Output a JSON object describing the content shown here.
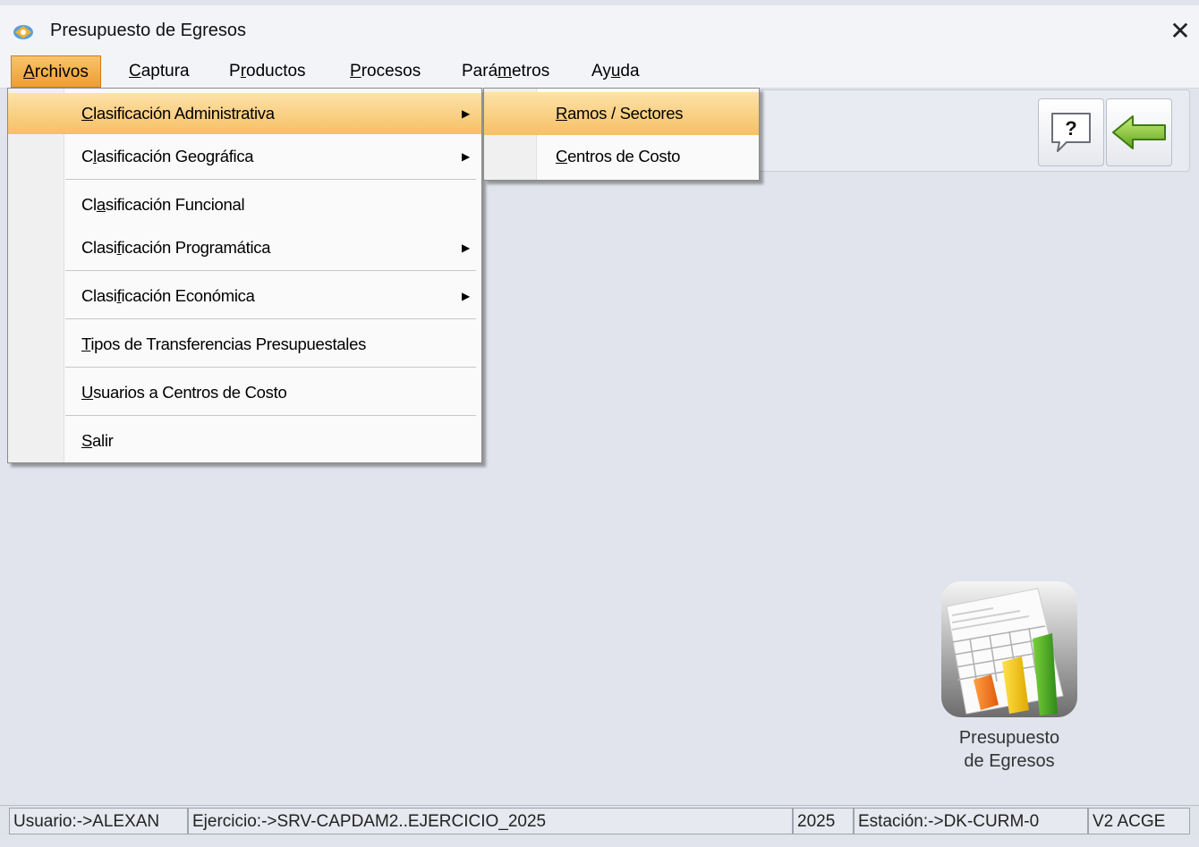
{
  "window": {
    "title": "Presupuesto de Egresos",
    "close_glyph": "✕"
  },
  "menubar": {
    "items": [
      {
        "label": "Archivos",
        "u": "A",
        "rest": "rchivos",
        "active": true
      },
      {
        "label": "Captura",
        "u": "C",
        "rest": "aptura"
      },
      {
        "label": "Productos",
        "pre": "P",
        "u": "r",
        "rest": "oductos"
      },
      {
        "label": "Procesos",
        "u": "P",
        "rest": "rocesos"
      },
      {
        "label": "Parámetros",
        "pre": "Pará",
        "u": "m",
        "rest": "etros"
      },
      {
        "label": "Ayuda",
        "pre": "Ay",
        "u": "u",
        "rest": "da"
      }
    ]
  },
  "dropdown": {
    "items": [
      {
        "pre": "",
        "u": "C",
        "rest": "lasificación Administrativa",
        "submenu": true
      },
      {
        "pre": "C",
        "u": "l",
        "rest": "asificación Geográfica",
        "submenu": true
      },
      {
        "pre": "Cl",
        "u": "a",
        "rest": "sificación Funcional",
        "submenu": false
      },
      {
        "pre": "Clasi",
        "u": "f",
        "rest": "icación Programática",
        "submenu": true
      },
      {
        "pre": "Clasi",
        "u": "f",
        "rest": "icación Económica",
        "submenu": true
      },
      {
        "pre": "",
        "u": "T",
        "rest": "ipos de Transferencias Presupuestales",
        "submenu": false
      },
      {
        "pre": "",
        "u": "U",
        "rest": "suarios a Centros de Costo",
        "submenu": false
      },
      {
        "pre": "",
        "u": "S",
        "rest": "alir",
        "submenu": false
      }
    ],
    "arrow_glyph": "▶"
  },
  "submenu": {
    "items": [
      {
        "u": "R",
        "rest": "amos / Sectores"
      },
      {
        "u": "C",
        "rest": "entros de Costo"
      }
    ]
  },
  "toolbar": {
    "help_glyph": "?"
  },
  "desktop_icon": {
    "label_line1": "Presupuesto",
    "label_line2": "de Egresos"
  },
  "statusbar": {
    "usuario": "Usuario:->ALEXAN",
    "ejercicio": "Ejercicio:->SRV-CAPDAM2..EJERCICIO_2025",
    "year": "2025",
    "estacion": "Estación:->DK-CURM-0",
    "version": "V2 ACGE"
  },
  "colors": {
    "accent": "#f6c065",
    "active_menu": "#ef9d34",
    "arrow_green": "#7fbf2c"
  }
}
